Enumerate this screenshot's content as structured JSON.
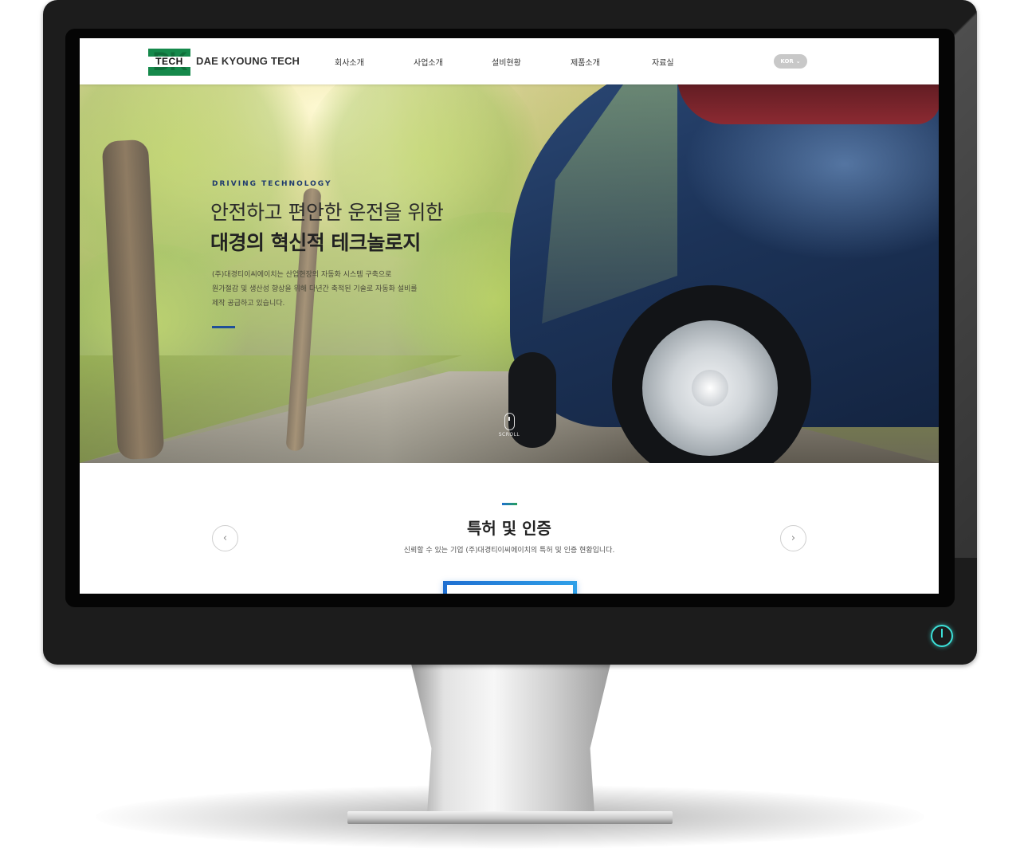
{
  "brand": {
    "logo_mark": "DK",
    "logo_sub": "TECH",
    "name": "DAE KYOUNG TECH",
    "color": "#15894b"
  },
  "nav": {
    "items": [
      {
        "label": "회사소개"
      },
      {
        "label": "사업소개"
      },
      {
        "label": "설비현황"
      },
      {
        "label": "제품소개"
      },
      {
        "label": "자료실"
      }
    ]
  },
  "language": {
    "selected": "KOR"
  },
  "hero": {
    "kicker": "DRIVING TECHNOLOGY",
    "title_line1": "안전하고 편안한 운전을 위한",
    "title_line2": "대경의 혁신적 테크놀로지",
    "description": [
      "(주)대경티이씨에이치는 산업현장의 자동화 시스템 구축으로",
      "원가절감 및 생산성 향상을 위해 다년간 축적된 기술로 자동화 설비를",
      "제작 공급하고 있습니다."
    ],
    "accent_color": "#1f4f99",
    "scroll_label": "SCROLL"
  },
  "section": {
    "title": "특허 및 인증",
    "subtitle": "신뢰할 수 있는 기업 (주)대경티이씨에이치의 특허 및 인증 현황입니다."
  },
  "icons": {
    "prev": "‹",
    "next": "›",
    "lang_chevron": "⌄"
  },
  "colors": {
    "monitor_bezel": "#1c1c1c",
    "power_led": "#3ce0d8"
  }
}
